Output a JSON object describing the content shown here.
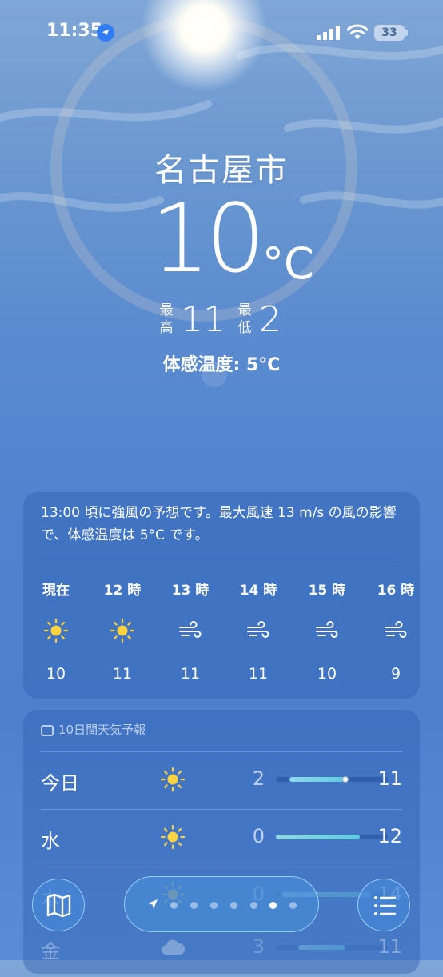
{
  "status_bar": {
    "time": "11:35",
    "battery": "33"
  },
  "hero": {
    "city": "名古屋市",
    "temperature": "10",
    "unit": "°C",
    "high_label_1": "最",
    "high_label_2": "高",
    "high": "11",
    "low_label_1": "最",
    "low_label_2": "低",
    "low": "2",
    "feels_like": "体感温度: 5°C"
  },
  "hourly": {
    "summary": "13:00 頃に強風の予想です。最大風速 13 m/s の風の影響で、体感温度は 5°C です。",
    "hours": [
      {
        "label": "現在",
        "icon": "sun-icon",
        "temp": "10"
      },
      {
        "label": "12 時",
        "icon": "sun-icon",
        "temp": "11"
      },
      {
        "label": "13 時",
        "icon": "wind-icon",
        "temp": "11"
      },
      {
        "label": "14 時",
        "icon": "wind-icon",
        "temp": "11"
      },
      {
        "label": "15 時",
        "icon": "wind-icon",
        "temp": "10"
      },
      {
        "label": "16 時",
        "icon": "wind-icon",
        "temp": "9"
      }
    ]
  },
  "daily": {
    "title": "10日間天気予報",
    "days": [
      {
        "name": "今日",
        "icon": "sun-icon",
        "low": "2",
        "high": "11",
        "bar_start": 0.12,
        "bar_end": 0.62,
        "current": 0.62
      },
      {
        "name": "水",
        "icon": "sun-icon",
        "low": "0",
        "high": "12",
        "bar_start": 0.0,
        "bar_end": 0.75
      },
      {
        "name": "木",
        "icon": "sun-icon",
        "low": "0",
        "high": "14",
        "bar_start": 0.05,
        "bar_end": 0.85
      },
      {
        "name": "金",
        "icon": "cloud-icon",
        "low": "3",
        "high": "11",
        "bar_start": 0.2,
        "bar_end": 0.62
      }
    ]
  },
  "pager": {
    "total": 7,
    "active_index": 5
  },
  "colors": {
    "accent": "#2f7cf6",
    "bar_fill": "#5fcbe0"
  }
}
